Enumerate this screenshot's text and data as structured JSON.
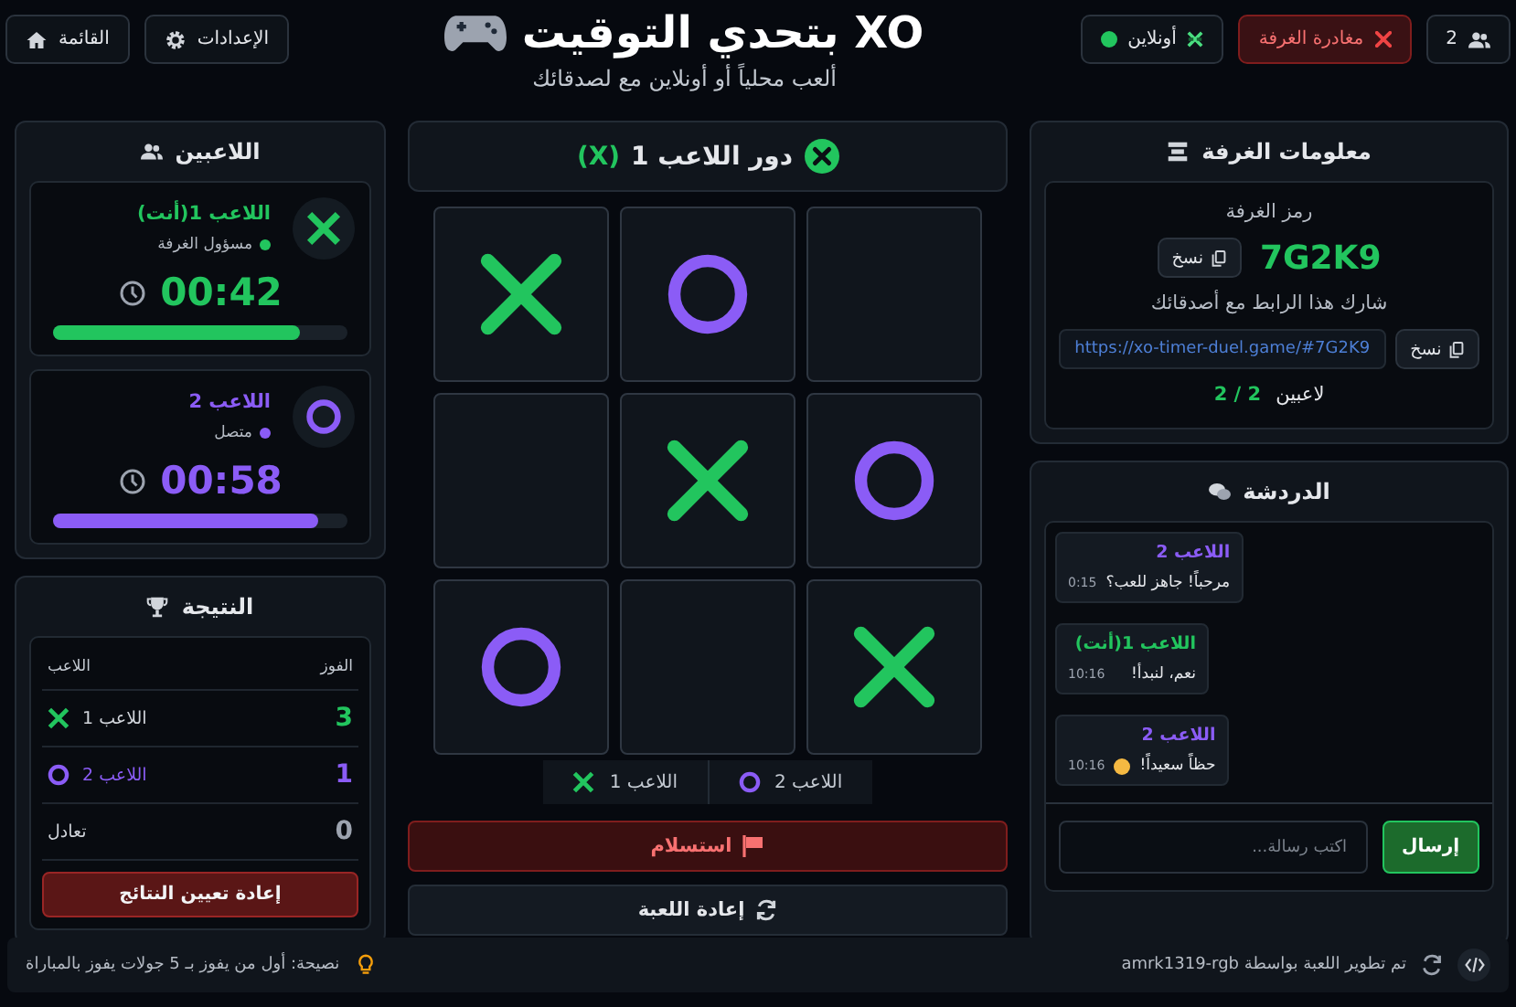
{
  "header": {
    "players_count": "2",
    "leave_button": "مغادرة الغرفة",
    "connection": {
      "label": "أونلاين",
      "online": true
    },
    "title": "XO بتحدي التوقيت",
    "subtitle": "ألعب محلياً أو أونلاين مع لصدقائك",
    "settings_button": "الإعدادات",
    "menu_button": "القائمة"
  },
  "room": {
    "title": "معلومات الغرفة",
    "code_label": "رمز الغرفة",
    "code": "7G2K9",
    "copy_button": "نسخ",
    "share_label": "شارك هذا الرابط مع أصدقائك",
    "link": "https://xo-timer-duel.game/#7G2K9",
    "link_copy_button": "نسخ",
    "players_label": "لاعبين",
    "players_value": "2 / 2"
  },
  "chat": {
    "title": "الدردشة",
    "messages": [
      {
        "sender": "اللاعب 2",
        "color": "#8b5cf6",
        "text": "مرحباً! جاهز للعب؟",
        "time": "0:15",
        "emoji": false
      },
      {
        "sender": "اللاعب 1(أنت)",
        "color": "#22c55e",
        "text": "نعم، لنبدأ!",
        "time": "10:16",
        "emoji": false
      },
      {
        "sender": "اللاعب 2",
        "color": "#8b5cf6",
        "text": "حظاً سعيداً!",
        "time": "10:16",
        "emoji": true
      }
    ],
    "input": {
      "placeholder": "اكتب رسالة..."
    },
    "send_button": "إرسال"
  },
  "turn": {
    "label": "دور اللاعب 1",
    "mark": "(X)",
    "kind": "x"
  },
  "board": [
    [
      {
        "kind": "x"
      },
      {
        "kind": "o"
      },
      {
        "kind": "empty"
      }
    ],
    [
      {
        "kind": "empty"
      },
      {
        "kind": "x"
      },
      {
        "kind": "o"
      }
    ],
    [
      {
        "kind": "o"
      },
      {
        "kind": "empty"
      },
      {
        "kind": "x"
      }
    ]
  ],
  "legend": [
    {
      "label": "اللاعب 2",
      "kind": "o"
    },
    {
      "label": "اللاعب 1",
      "kind": "x"
    }
  ],
  "surrender_button": "استسلام",
  "restart_button": "إعادة اللعبة",
  "players": {
    "title": "اللاعبين",
    "items": [
      {
        "name": "اللاعب 1(أنت)",
        "kind": "x",
        "color": "#22c55e",
        "status": "مسؤول الغرفة",
        "time": "00:42",
        "level": 0.84
      },
      {
        "name": "اللاعب 2",
        "kind": "o",
        "color": "#8b5cf6",
        "status": "متصل",
        "time": "00:58",
        "level": 0.9
      }
    ]
  },
  "score": {
    "title": "النتيجة",
    "columns": [
      "الفوز",
      "اللاعب"
    ],
    "rows": [
      {
        "label": "اللاعب 1",
        "kind": "x",
        "wins": "3"
      },
      {
        "label": "اللاعب 2",
        "kind": "o",
        "wins": "1"
      },
      {
        "label": "تعادل",
        "kind": "draw",
        "wins": "0"
      }
    ],
    "reset_button": "إعادة تعيين النتائج"
  },
  "footer": {
    "credit": "تم تطوير اللعبة بواسطة amrk1319-rgb",
    "tip": "نصيحة: أول من يفوز بـ 5 جولات يفوز بالمباراة"
  }
}
